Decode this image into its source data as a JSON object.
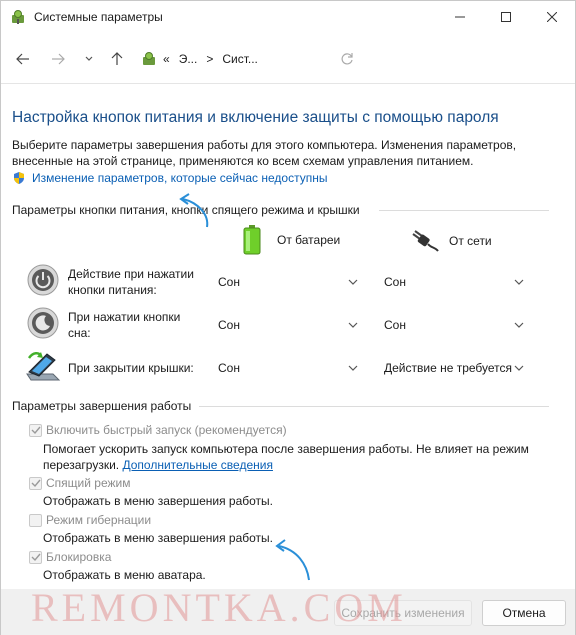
{
  "window": {
    "title": "Системные параметры",
    "icon": "power-options-icon"
  },
  "nav": {
    "breadcrumb": [
      "«",
      "Э...",
      ">",
      "Сист..."
    ],
    "icons": [
      "back-arrow-icon",
      "forward-arrow-icon",
      "chevron-down-icon",
      "up-arrow-icon",
      "refresh-icon"
    ]
  },
  "main": {
    "heading": "Настройка кнопок питания и включение защиты с помощью пароля",
    "description": "Выберите параметры завершения работы для этого компьютера. Изменения параметров, внесенные на этой странице, применяются ко всем схемам управления питанием.",
    "admin_link": "Изменение параметров, которые сейчас недоступны"
  },
  "power_buttons": {
    "section_title": "Параметры кнопки питания, кнопки спящего режима и крышки",
    "col_battery": "От батареи",
    "col_plugged": "От сети",
    "rows": [
      {
        "label": "Действие при нажатии кнопки питания:",
        "battery": "Сон",
        "plugged": "Сон",
        "icon": "power-button-icon"
      },
      {
        "label": "При нажатии кнопки сна:",
        "battery": "Сон",
        "plugged": "Сон",
        "icon": "sleep-button-icon"
      },
      {
        "label": "При закрытии крышки:",
        "battery": "Сон",
        "plugged": "Действие не требуется",
        "icon": "laptop-lid-icon"
      }
    ]
  },
  "shutdown": {
    "section_title": "Параметры завершения работы",
    "items": [
      {
        "label": "Включить быстрый запуск (рекомендуется)",
        "checked": true,
        "desc_line1": "Помогает ускорить запуск компьютера после завершения работы. Не влияет на режим",
        "desc_line2": "перезагрузки.",
        "desc_link": "Дополнительные сведения"
      },
      {
        "label": "Спящий режим",
        "checked": true,
        "desc": "Отображать в меню завершения работы."
      },
      {
        "label": "Режим гибернации",
        "checked": false,
        "desc": "Отображать в меню завершения работы."
      },
      {
        "label": "Блокировка",
        "checked": true,
        "desc": "Отображать в меню аватара."
      }
    ]
  },
  "footer": {
    "save_label": "Сохранить изменения",
    "cancel_label": "Отмена",
    "watermark": "REMONTKA.COM"
  },
  "colors": {
    "heading": "#1a4f8a",
    "link": "#0a5fb4",
    "annotation_arrow": "#2a8fd8"
  }
}
